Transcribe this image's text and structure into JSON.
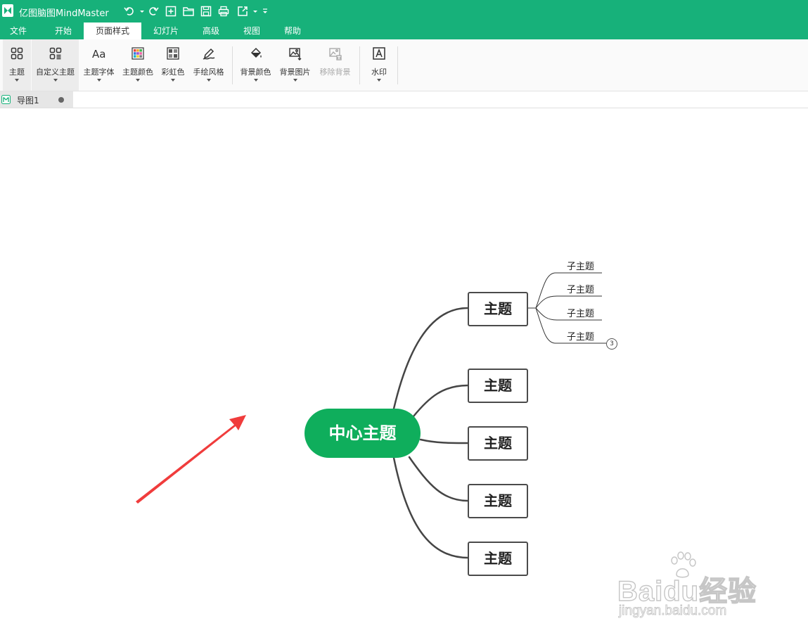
{
  "app": {
    "title": "亿图脑图MindMaster",
    "accent_color": "#17b17a",
    "quick_access": [
      "undo-icon",
      "redo-icon",
      "new-file-icon",
      "open-folder-icon",
      "save-icon",
      "print-icon",
      "export-icon",
      "customize-toolbar-icon"
    ]
  },
  "menu": {
    "items": [
      "文件",
      "开始",
      "页面样式",
      "幻灯片",
      "高级",
      "视图",
      "帮助"
    ],
    "active": "页面样式"
  },
  "ribbon": {
    "buttons": [
      {
        "label": "主题",
        "icon": "theme-grid-icon",
        "enabled": true
      },
      {
        "label": "自定义主题",
        "icon": "custom-theme-icon",
        "enabled": true
      },
      {
        "label": "主题字体",
        "icon": "font-aa-icon",
        "enabled": true
      },
      {
        "label": "主题颜色",
        "icon": "color-palette-icon",
        "enabled": true
      },
      {
        "label": "彩虹色",
        "icon": "rainbow-grid-icon",
        "enabled": true
      },
      {
        "label": "手绘风格",
        "icon": "hand-drawn-pen-icon",
        "enabled": true
      },
      {
        "label": "背景颜色",
        "icon": "paint-bucket-icon",
        "enabled": true
      },
      {
        "label": "背景图片",
        "icon": "background-image-icon",
        "enabled": true
      },
      {
        "label": "移除背景",
        "icon": "remove-background-icon",
        "enabled": false
      },
      {
        "label": "水印",
        "icon": "watermark-icon",
        "enabled": true
      }
    ]
  },
  "document_tab": {
    "label": "导图1",
    "icon": "mindmap-file-icon"
  },
  "mindmap": {
    "central_topic": "中心主题",
    "central_color": "#0fae5c",
    "topics": [
      "主题",
      "主题",
      "主题",
      "主题",
      "主题"
    ],
    "subtopics": [
      "子主题",
      "子主题",
      "子主题",
      "子主题"
    ],
    "collapsed_count": "3"
  },
  "annotation": {
    "arrow_color": "#f03c3c"
  },
  "watermark": {
    "logo_text": "Baidu经验",
    "url": "jingyan.baidu.com"
  }
}
